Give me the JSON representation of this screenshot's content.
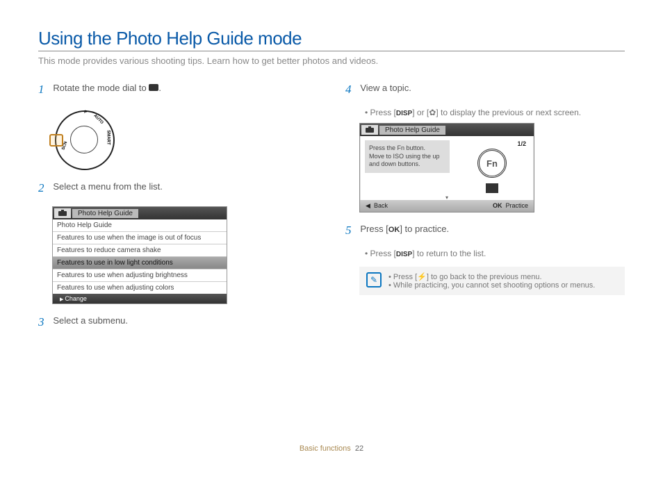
{
  "title": "Using the Photo Help Guide mode",
  "intro": "This mode provides various shooting tips. Learn how to get better photos and videos.",
  "steps": {
    "s1": {
      "text": "Rotate the mode dial to ",
      "tail": "."
    },
    "s2": {
      "text": "Select a menu from the list."
    },
    "s3": {
      "text": "Select a submenu."
    },
    "s4": {
      "text": "View a topic."
    },
    "s4_bullet_pre": "Press [",
    "s4_bullet_mid": "] or [",
    "s4_bullet_post": "] to display the previous or next screen.",
    "s5_pre": "Press [",
    "s5_post": "] to practice.",
    "s5_bullet_pre": "Press [",
    "s5_bullet_post": "] to return to the list."
  },
  "disp_label": "DISP",
  "ok_label": "OK",
  "menu": {
    "title": "Photo Help Guide",
    "items": [
      "Photo Help Guide",
      "Features to use when the image is out of focus",
      "Features to reduce camera shake",
      "Features to use in low light conditions",
      "Features to use when adjusting brightness",
      "Features to use when adjusting colors"
    ],
    "selected_index": 3,
    "footer": "Change"
  },
  "screen": {
    "title": "Photo Help Guide",
    "page": "1/2",
    "body": "Press the Fn button.\nMove to ISO using the up and down buttons.",
    "fn_label": "Fn",
    "back": "Back",
    "practice_pre": "OK",
    "practice": "Practice"
  },
  "notes": [
    {
      "pre": "Press [",
      "post": "] to go back to the previous menu."
    },
    {
      "text": "While practicing, you cannot set shooting options or menus."
    }
  ],
  "dial_labels": [
    "P",
    "AUTO",
    "SMART",
    "SCN"
  ],
  "footer": {
    "section": "Basic functions",
    "page": "22"
  }
}
